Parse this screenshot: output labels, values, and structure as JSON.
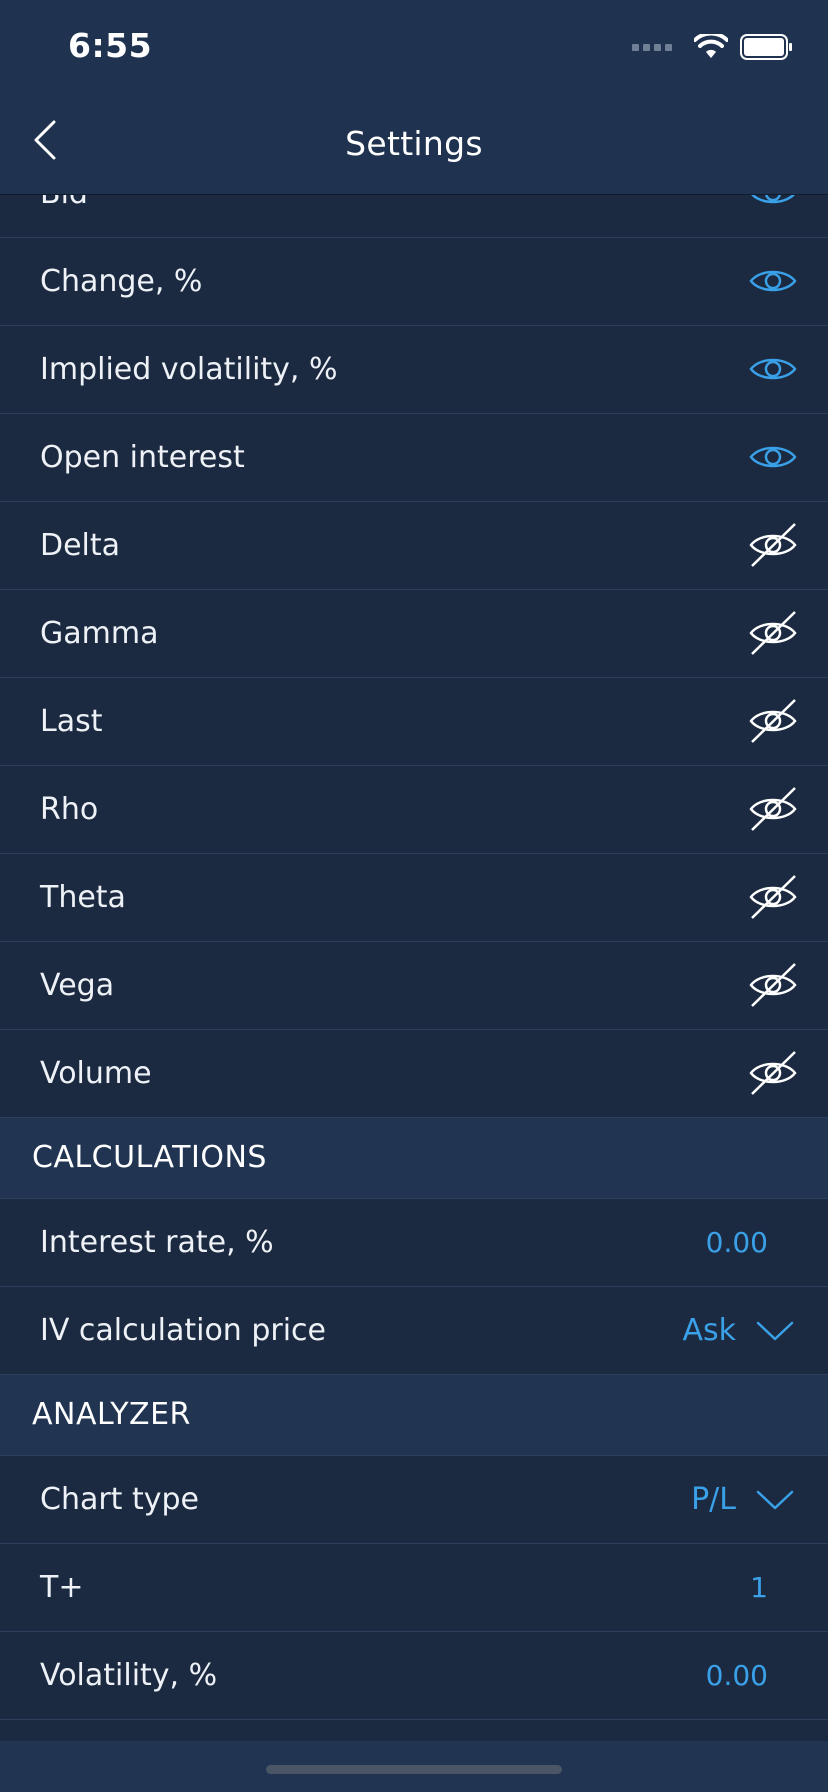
{
  "status_bar": {
    "time": "6:55"
  },
  "nav": {
    "title": "Settings"
  },
  "columns": [
    {
      "label": "Bid",
      "visible": true
    },
    {
      "label": "Change, %",
      "visible": true
    },
    {
      "label": "Implied volatility, %",
      "visible": true
    },
    {
      "label": "Open interest",
      "visible": true
    },
    {
      "label": "Delta",
      "visible": false
    },
    {
      "label": "Gamma",
      "visible": false
    },
    {
      "label": "Last",
      "visible": false
    },
    {
      "label": "Rho",
      "visible": false
    },
    {
      "label": "Theta",
      "visible": false
    },
    {
      "label": "Vega",
      "visible": false
    },
    {
      "label": "Volume",
      "visible": false
    }
  ],
  "calculations": {
    "title": "CALCULATIONS",
    "interest_rate": {
      "label": "Interest rate, %",
      "value": "0.00"
    },
    "iv_price": {
      "label": "IV calculation price",
      "value": "Ask"
    }
  },
  "analyzer": {
    "title": "ANALYZER",
    "chart_type": {
      "label": "Chart type",
      "value": "P/L"
    },
    "t_plus": {
      "label": "T+",
      "value": "1"
    },
    "volatility": {
      "label": "Volatility, %",
      "value": "0.00"
    }
  },
  "colors": {
    "accent": "#3aa0e8",
    "background": "#1b2a40",
    "header": "#1f3350"
  }
}
